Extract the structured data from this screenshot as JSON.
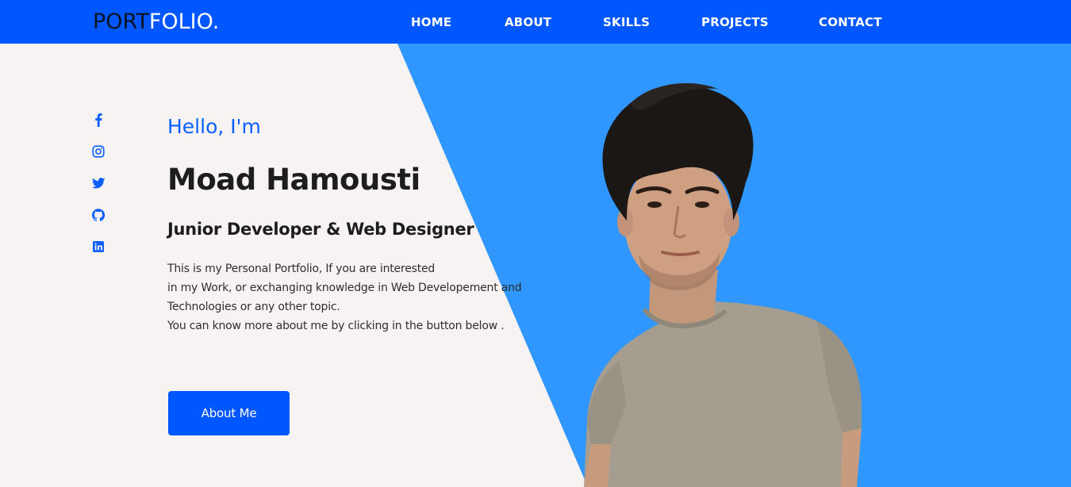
{
  "navbar": {
    "logo_part1": "PORT",
    "logo_part2": "FOLIO.",
    "links": [
      {
        "label": "HOME"
      },
      {
        "label": "ABOUT"
      },
      {
        "label": "SKILLS"
      },
      {
        "label": "PROJECTS"
      },
      {
        "label": "CONTACT"
      }
    ]
  },
  "social": [
    {
      "icon": "facebook-icon"
    },
    {
      "icon": "instagram-icon"
    },
    {
      "icon": "twitter-icon"
    },
    {
      "icon": "github-icon"
    },
    {
      "icon": "linkedin-icon"
    }
  ],
  "hero": {
    "greeting": "Hello, I'm",
    "name": "Moad Hamousti",
    "role": "Junior Developer & Web Designer",
    "description": [
      "This is my Personal Portfolio, If you are interested",
      "in my Work, or exchanging knowledge in Web Developement and",
      "Technologies or any other topic.",
      "You can know more about me by clicking in the button below ."
    ],
    "button_label": "About Me"
  },
  "colors": {
    "nav_bg": "#0057ff",
    "panel_blue": "#2f97ff",
    "page_bg": "#f8f3f3",
    "accent": "#0b5fff",
    "logo_dark": "#0c1422"
  }
}
